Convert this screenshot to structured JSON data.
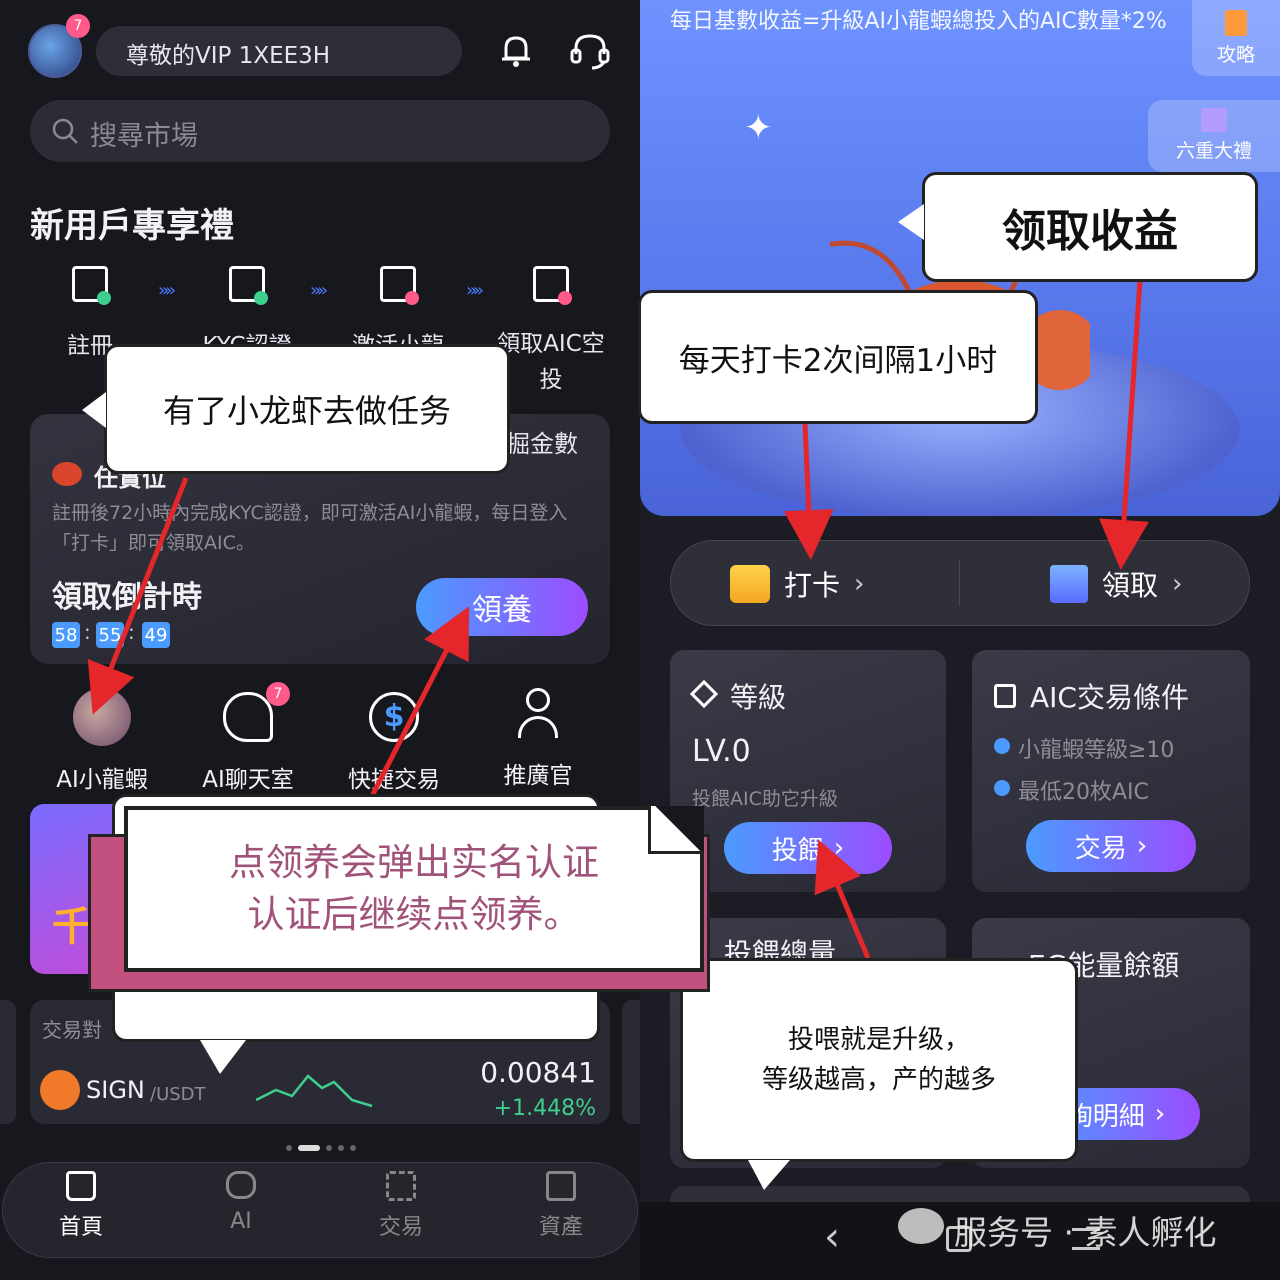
{
  "left": {
    "avatar_badge": "7",
    "vip_label": "尊敬的VIP 1XEE3H",
    "search_placeholder": "搜尋市場",
    "section_title": "新用戶專享禮",
    "steps": [
      {
        "label": "註冊",
        "icon": "register-icon"
      },
      {
        "label": "KYC認證",
        "icon": "kyc-icon"
      },
      {
        "label": "激活小龍",
        "icon": "chip-icon"
      },
      {
        "label": "領取AIC空投",
        "icon": "gift-box-icon"
      }
    ],
    "card": {
      "title_partial": "任實位",
      "right_partial": "掘金數",
      "desc": "註冊後72小時內完成KYC認證，即可激活AI小龍蝦，每日登入「打卡」即可領取AIC。",
      "countdown_label": "領取倒計時",
      "countdown": [
        "58",
        "55",
        "49"
      ],
      "claim_button": "領養"
    },
    "features": [
      {
        "label": "AI小龍蝦",
        "icon": "lobster-avatar-icon",
        "badge": ""
      },
      {
        "label": "AI聊天室",
        "icon": "chat-room-icon",
        "badge": "7"
      },
      {
        "label": "快捷交易",
        "icon": "quick-trade-icon",
        "badge": ""
      },
      {
        "label": "推廣官",
        "icon": "promoter-icon",
        "badge": ""
      }
    ],
    "banner_partial": "千",
    "market": {
      "header": "交易對",
      "symbol": "SIGN",
      "quote": "/USDT",
      "price": "0.00841",
      "change": "+1.448%"
    },
    "nav": [
      {
        "label": "首頁",
        "icon": "home-icon",
        "active": true
      },
      {
        "label": "AI",
        "icon": "robot-icon",
        "active": false
      },
      {
        "label": "交易",
        "icon": "trade-icon",
        "active": false
      },
      {
        "label": "資產",
        "icon": "wallet-icon",
        "active": false
      }
    ]
  },
  "right": {
    "header_text": "每日基數收益=升級AI小龍蝦總投入的AIC數量*2%",
    "side_buttons": [
      {
        "label": "攻略",
        "icon": "book-icon"
      },
      {
        "label": "六重大禮",
        "icon": "gift-icon"
      }
    ],
    "actions": [
      {
        "label": "打卡",
        "icon": "calendar-check-icon"
      },
      {
        "label": "領取",
        "icon": "gift-icon"
      }
    ],
    "level_card": {
      "title": "等級",
      "level": "LV.0",
      "desc": "投餵AIC助它升級",
      "button": "投餵"
    },
    "condition_card": {
      "title": "AIC交易條件",
      "items": [
        "小龍蝦等級≥10",
        "最低20枚AIC"
      ],
      "button": "交易"
    },
    "feed_total_partial": "投餵總量",
    "energy_title_partial": "EG能量餘額",
    "detail_button_partial": "詢明細",
    "watermark": "服务号 · 素人孵化"
  },
  "annotations": {
    "left_top": "有了小龙虾去做任务",
    "left_middle_line1": "点领养会弹出实名认证",
    "left_middle_line2": "认证后继续点领养。",
    "right_top": "领取收益",
    "right_middle": "每天打卡2次间隔1小时",
    "right_bottom_line1": "投喂就是升级，",
    "right_bottom_line2": "等级越高，产的越多"
  },
  "colors": {
    "accent_gradient_start": "#4b9bff",
    "accent_gradient_end": "#9b4dff",
    "positive": "#3ecf8e",
    "annotation_arrow": "#e5262b",
    "annotation_text_pink": "#a0527a",
    "annotation_frame_pink": "#c2507e"
  }
}
